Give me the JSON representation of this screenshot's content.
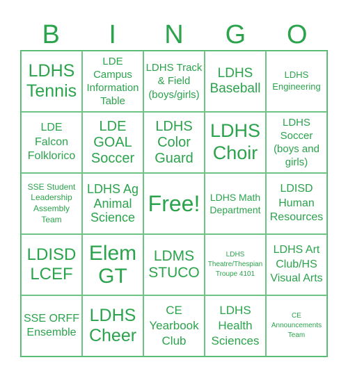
{
  "header": {
    "letters": [
      "B",
      "I",
      "N",
      "G",
      "O"
    ]
  },
  "theme": {
    "text_color": "#2ba34c",
    "grid_color": "#6cc383",
    "background": "#ffffff"
  },
  "cells": [
    [
      "LDHS Tennis",
      "LDE Campus Information Table",
      "LDHS Track & Field (boys/girls)",
      "LDHS Baseball",
      "LDHS Engineering"
    ],
    [
      "LDE Falcon Folklorico",
      "LDE GOAL Soccer",
      "LDHS Color Guard",
      "LDHS Choir",
      "LDHS Soccer (boys and girls)"
    ],
    [
      "SSE Student Leadership Assembly Team",
      "LDHS Ag Animal Science",
      "Free!",
      "LDHS Math Department",
      "LDISD Human Resources"
    ],
    [
      "LDISD LCEF",
      "Elem GT",
      "LDMS STUCO",
      "LDHS Theatre/Thespian Troupe 4101",
      "LDHS Art Club/HS Visual Arts"
    ],
    [
      "SSE ORFF Ensemble",
      "LDHS Cheer",
      "CE Yearbook Club",
      "LDHS Health Sciences",
      "CE Announcements Team"
    ]
  ]
}
